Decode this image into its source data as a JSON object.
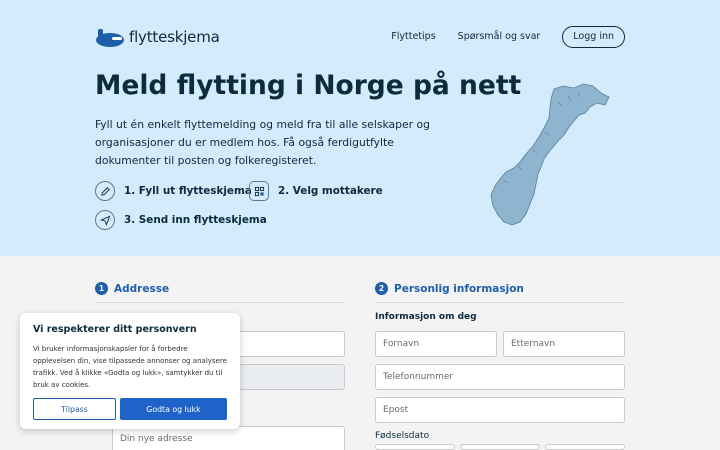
{
  "brand": {
    "name": "flytteskjema"
  },
  "nav": {
    "items": [
      "Flyttetips",
      "Spørsmål og svar"
    ],
    "login_label": "Logg inn"
  },
  "hero": {
    "title": "Meld flytting i Norge på nett",
    "lead": "Fyll ut én enkelt flyttemelding og meld fra til alle selskaper og organisasjoner du er medlem hos. Få også ferdigutfylte dokumenter til posten og folkeregisteret.",
    "steps": [
      "1. Fyll ut flytteskjema",
      "2. Velg mottakere",
      "3. Send inn flytteskjema"
    ],
    "step_icons": [
      "pencil-icon",
      "grid-icon",
      "send-icon"
    ]
  },
  "form": {
    "address": {
      "number": "1",
      "title": "Addresse",
      "new_address_placeholder": "Din nye adresse"
    },
    "personal": {
      "number": "2",
      "title": "Personlig informasjon",
      "subtitle": "Informasjon om deg",
      "first_name_placeholder": "Fornavn",
      "last_name_placeholder": "Etternavn",
      "phone_placeholder": "Telefonnummer",
      "email_placeholder": "Epost",
      "birthdate_label": "Fødselsdato"
    }
  },
  "cookie": {
    "title": "Vi respekterer ditt personvern",
    "text": "Vi bruker informasjonskapsler for å forbedre opplevelsen din, vise tilpassede annonser og analysere trafikk. Ved å klikke «Godta og lukk», samtykker du til bruk av cookies.",
    "customize_label": "Tilpass",
    "accept_label": "Godta og lukk"
  },
  "colors": {
    "hero_bg": "#d3ebfa",
    "accent": "#1f5ea8",
    "primary_button": "#1f62c8",
    "text_dark": "#0d2b3e",
    "map_fill": "#8fb4cf"
  }
}
